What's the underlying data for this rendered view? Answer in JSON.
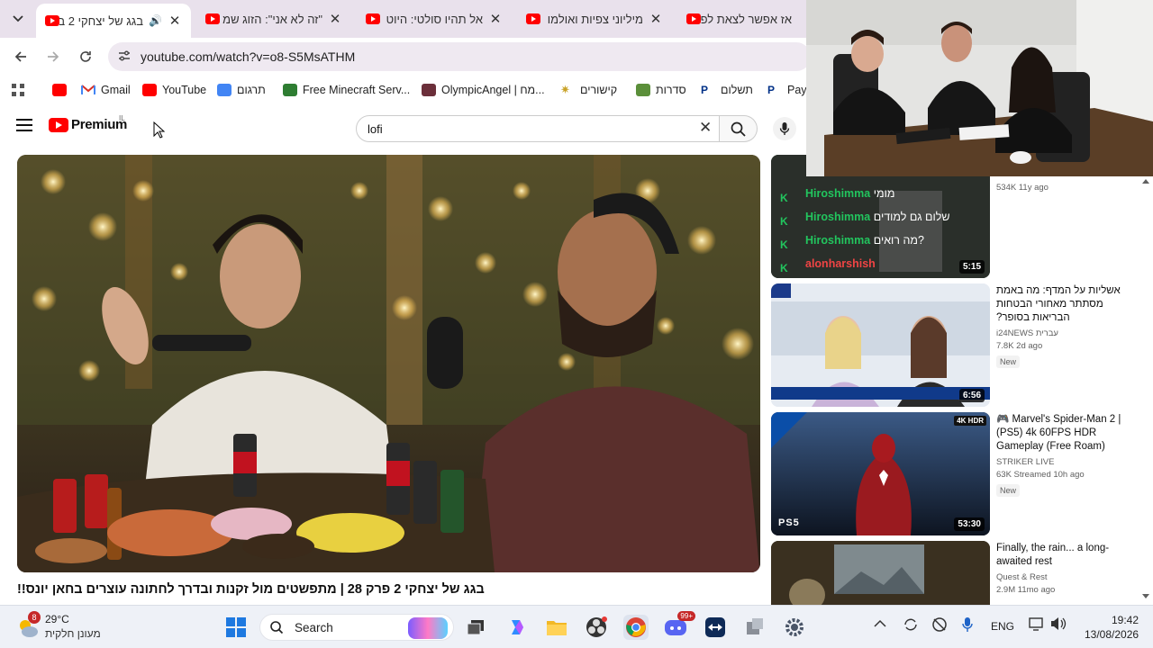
{
  "browser": {
    "tabs": [
      {
        "title": "בגג של יצחקי 2 ב",
        "active": true,
        "audio": true
      },
      {
        "title": "\"זה לא אני\": הזוג שמ",
        "active": false
      },
      {
        "title": "אל תהיו סולטי: היוט",
        "active": false
      },
      {
        "title": "מיליוני צפיות ואולמו",
        "active": false
      },
      {
        "title": "אז אפשר לצאת לפנ",
        "active": false
      }
    ],
    "url": "youtube.com/watch?v=o8-S5MsATHM",
    "bookmarks": [
      {
        "label": "Gmail",
        "icon": "gmail-icon"
      },
      {
        "label": "YouTube",
        "icon": "youtube-icon"
      },
      {
        "label": "תרגום",
        "icon": "translate-icon"
      },
      {
        "label": "Free Minecraft Serv...",
        "icon": "minecraft-icon"
      },
      {
        "label": "OlympicAngel | מח...",
        "icon": "profile-icon"
      },
      {
        "label": "קישורים",
        "icon": "sparkle-icon"
      },
      {
        "label": "סדרות",
        "icon": "tv-icon"
      },
      {
        "label": "תשלום",
        "icon": "paypal-icon"
      },
      {
        "label": "Payl",
        "icon": "paypal-icon"
      }
    ]
  },
  "youtube": {
    "logo_text": "Premium",
    "logo_country": "IL",
    "search_query": "lofi",
    "video_title": "בגג של יצחקי 2 פרק 28 | מתפשטים מול זקנות ובדרך לחתונה עוצרים בחאן יונס!!",
    "sidebar": [
      {
        "title": "",
        "channel": "",
        "stats": "534K  11y ago",
        "duration": "5:15",
        "chat": [
          {
            "user": "Hiroshimma",
            "msg": "מומי"
          },
          {
            "user": "Hiroshimma",
            "msg": "שלום גם למודים"
          },
          {
            "user": "Hiroshimma",
            "msg": "מה רואים?"
          },
          {
            "user": "alonharshish",
            "msg": ""
          }
        ]
      },
      {
        "title": "אשליות על המדף: מה באמת מסתתר מאחורי הבטחות הבריאות בסופר?",
        "channel": "i24NEWS עברית",
        "stats": "7.8K  2d ago",
        "badge": "New",
        "duration": "6:56"
      },
      {
        "title": "🎮 Marvel's Spider-Man 2 | (PS5) 4k 60FPS HDR Gameplay (Free Roam)",
        "channel": "STRIKER LIVE",
        "stats": "63K  Streamed 10h ago",
        "badge": "New",
        "duration": "53:30",
        "thumb_badge": "4K HDR",
        "platform": "PS5"
      },
      {
        "title": "Finally, the rain... a long-awaited rest",
        "channel": "Quest & Rest",
        "stats": "2.9M  11mo ago"
      }
    ]
  },
  "taskbar": {
    "weather_temp": "29°C",
    "weather_desc": "מעונן חלקית",
    "weather_badge": "8",
    "search_label": "Search",
    "discord_badge": "99+",
    "lang": "ENG",
    "time": "19:42",
    "date": "13/08/2026"
  },
  "colors": {
    "youtube_red": "#ff0000",
    "tabstrip": "#e9e1ec",
    "taskbar": "#eef1f7"
  }
}
